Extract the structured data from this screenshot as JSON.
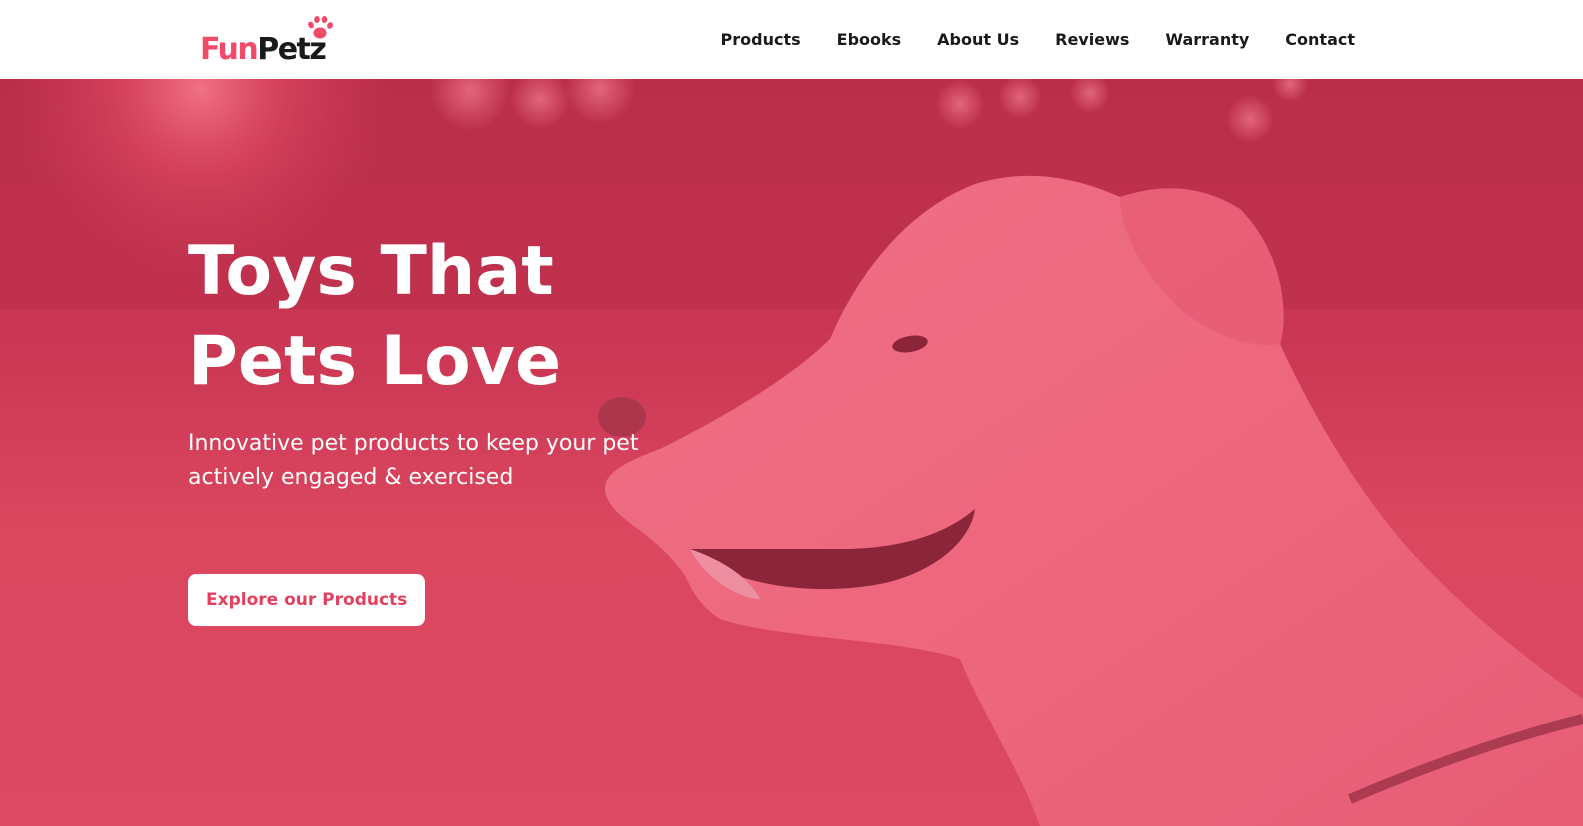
{
  "header": {
    "logo": {
      "part1": "Fun",
      "part2": "Petz",
      "icon": "paw-icon"
    },
    "nav": [
      {
        "label": "Products"
      },
      {
        "label": "Ebooks"
      },
      {
        "label": "About Us"
      },
      {
        "label": "Reviews"
      },
      {
        "label": "Warranty"
      },
      {
        "label": "Contact"
      }
    ]
  },
  "hero": {
    "title": "Toys That Pets Love",
    "subtitle": "Innovative pet products to keep your pet actively engaged & exercised",
    "cta_label": "Explore our Products",
    "background_image": "white-dog-smiling-photo",
    "overlay_color": "#e2405f"
  },
  "colors": {
    "brand": "#f14a6a",
    "dark_text": "#1a1a1a",
    "hero_overlay": "#d84663"
  }
}
